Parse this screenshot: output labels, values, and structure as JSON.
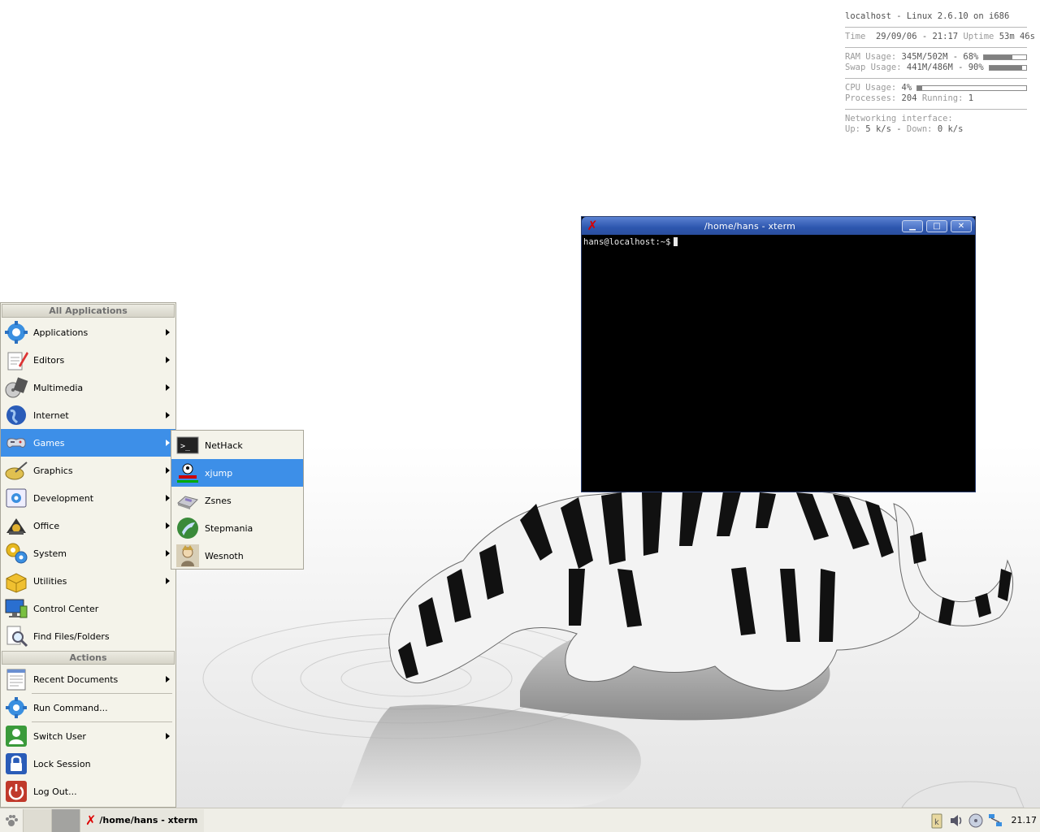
{
  "conky": {
    "host": "localhost - Linux 2.6.10 on i686",
    "time_label": "Time",
    "time_value": "29/09/06 - 21:17",
    "uptime_label": "Uptime",
    "uptime_value": "53m 46s",
    "ram_label": "RAM Usage:",
    "ram_value": "345M/502M - 68%",
    "ram_fraction": 0.68,
    "swap_label": "Swap Usage:",
    "swap_value": "441M/486M - 90%",
    "swap_fraction": 0.9,
    "cpu_label": "CPU Usage:",
    "cpu_value": "4%",
    "cpu_fraction": 0.04,
    "processes_label": "Processes:",
    "processes_value": "204",
    "running_label": "Running:",
    "running_value": "1",
    "net_label": "Networking interface:",
    "net_up_label": "Up:",
    "net_up_value": "5 k/s",
    "net_down_label": "Down:",
    "net_down_value": "0 k/s"
  },
  "xterm": {
    "title": "/home/hans - xterm",
    "prompt": "hans@localhost:~$"
  },
  "kmenu": {
    "all_apps_header": "All Applications",
    "actions_header": "Actions",
    "items": [
      {
        "label": "Applications",
        "icon": "applications-icon"
      },
      {
        "label": "Editors",
        "icon": "editors-icon"
      },
      {
        "label": "Multimedia",
        "icon": "multimedia-icon"
      },
      {
        "label": "Internet",
        "icon": "internet-icon"
      },
      {
        "label": "Games",
        "icon": "games-icon"
      },
      {
        "label": "Graphics",
        "icon": "graphics-icon"
      },
      {
        "label": "Development",
        "icon": "development-icon"
      },
      {
        "label": "Office",
        "icon": "office-icon"
      },
      {
        "label": "System",
        "icon": "system-icon"
      },
      {
        "label": "Utilities",
        "icon": "utilities-icon"
      },
      {
        "label": "Control Center",
        "icon": "control-center-icon"
      },
      {
        "label": "Find Files/Folders",
        "icon": "find-files-icon"
      }
    ],
    "actions": [
      {
        "label": "Recent Documents",
        "icon": "recent-documents-icon"
      },
      {
        "label": "Run Command...",
        "icon": "run-command-icon"
      },
      {
        "label": "Switch User",
        "icon": "switch-user-icon"
      },
      {
        "label": "Lock Session",
        "icon": "lock-icon"
      },
      {
        "label": "Log Out...",
        "icon": "logout-icon"
      }
    ]
  },
  "games_submenu": {
    "items": [
      {
        "label": "NetHack",
        "icon": "terminal-icon"
      },
      {
        "label": "xjump",
        "icon": "xjump-icon"
      },
      {
        "label": "Zsnes",
        "icon": "snes-console-icon"
      },
      {
        "label": "Stepmania",
        "icon": "stepmania-icon"
      },
      {
        "label": "Wesnoth",
        "icon": "wesnoth-icon"
      }
    ]
  },
  "taskbar": {
    "task_label": "/home/hans - xterm",
    "clock": "21.17"
  },
  "colors": {
    "menu_highlight": "#3d8fe8",
    "titlebar": "#2d56ae",
    "menu_bg": "#f4f3ea"
  }
}
